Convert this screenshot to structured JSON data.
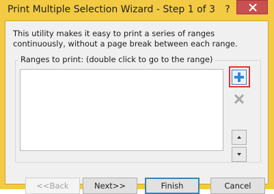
{
  "window": {
    "title": "Print Multiple Selection Wizard - Step 1 of 3",
    "help_glyph": "?",
    "close_icon": "close-icon"
  },
  "description": "This utility makes it easy to print a series of ranges continuously, without a page break between each range.",
  "ranges_group": {
    "label": "Ranges to print: (double click to go to the range)",
    "items": []
  },
  "side_buttons": {
    "add_icon": "plus-icon",
    "delete_icon": "delete-x-icon",
    "up_icon": "arrow-up-icon",
    "down_icon": "arrow-down-icon"
  },
  "buttons": {
    "back": "<<Back",
    "next": "Next>>",
    "finish": "Finish",
    "cancel": "Cancel"
  },
  "colors": {
    "title_bar": "#f3ca44",
    "close_button": "#c75050",
    "highlight": "#e03030",
    "plus_icon": "#2f88d8",
    "delete_icon": "#a8a8a8"
  }
}
